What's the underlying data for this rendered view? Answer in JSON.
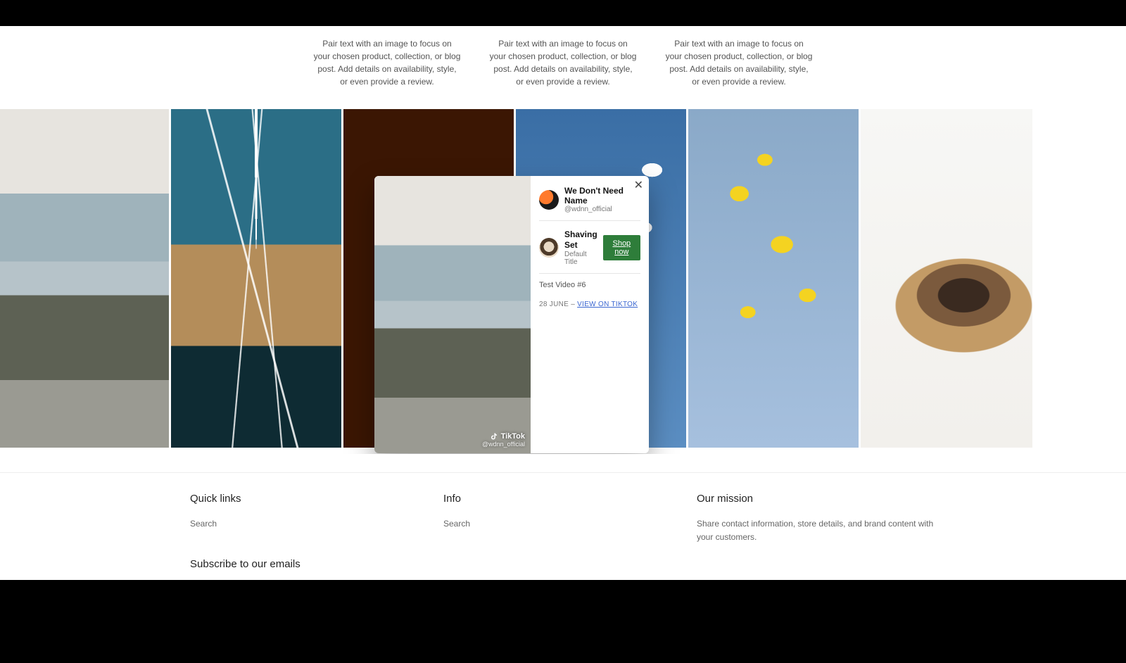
{
  "promo": {
    "text": "Pair text with an image to focus on your chosen product, collection, or blog post. Add details on availability, style, or even provide a review."
  },
  "card": {
    "profile_name": "We Don't Need Name",
    "profile_handle": "@wdnn_official",
    "product_title": "Shaving Set",
    "product_variant": "Default Title",
    "shop_button": "Shop now",
    "video_title": "Test Video #6",
    "post_date": "28 JUNE",
    "date_separator": " – ",
    "view_link_text": "VIEW ON TIKTOK",
    "tiktok_brand": "TikTok",
    "tiktok_handle": "@wdnn_official"
  },
  "footer": {
    "col1_title": "Quick links",
    "col1_link": "Search",
    "col2_title": "Info",
    "col2_link": "Search",
    "col3_title": "Our mission",
    "col3_text": "Share contact information, store details, and brand content with your customers.",
    "subscribe_title": "Subscribe to our emails"
  }
}
